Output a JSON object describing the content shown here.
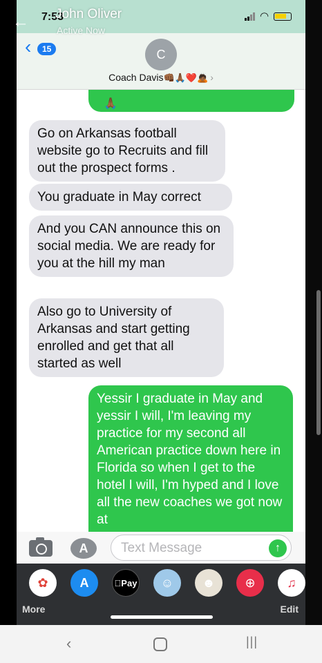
{
  "overlay": {
    "name": "John Oliver",
    "status": "Active Now"
  },
  "status_bar": {
    "time": "7:53"
  },
  "nav": {
    "badge_count": "15",
    "avatar_initial": "C",
    "contact_name": "Coach Davis",
    "contact_emoji": "👊🏾🙏🏾❤️🙇🏾"
  },
  "messages": [
    {
      "direction": "outgoing",
      "text": "🙏🏾"
    },
    {
      "direction": "incoming",
      "text": "Go on Arkansas football website go to Recruits and fill out the prospect forms ."
    },
    {
      "direction": "incoming",
      "text": "You graduate in May correct"
    },
    {
      "direction": "incoming",
      "text": "And you CAN announce this on social media.   We are ready for you at the hill my man"
    },
    {
      "direction": "incoming",
      "text": "Also go to University of Arkansas and start getting enrolled and get that all started as well"
    },
    {
      "direction": "outgoing",
      "text": "Yessir I graduate in May and yessir I will, I'm leaving my practice for my second all American practice down here in Florida so when I get to the hotel I will, I'm hyped and I love all the new coaches we got now at"
    }
  ],
  "input": {
    "placeholder": "Text Message"
  },
  "drawer": {
    "more_label": "More",
    "edit_label": "Edit",
    "apple_pay_label": "Pay"
  },
  "colors": {
    "imessage_green": "#2fc64d",
    "incoming_gray": "#e5e5ea",
    "ios_blue": "#1b7bf0"
  }
}
